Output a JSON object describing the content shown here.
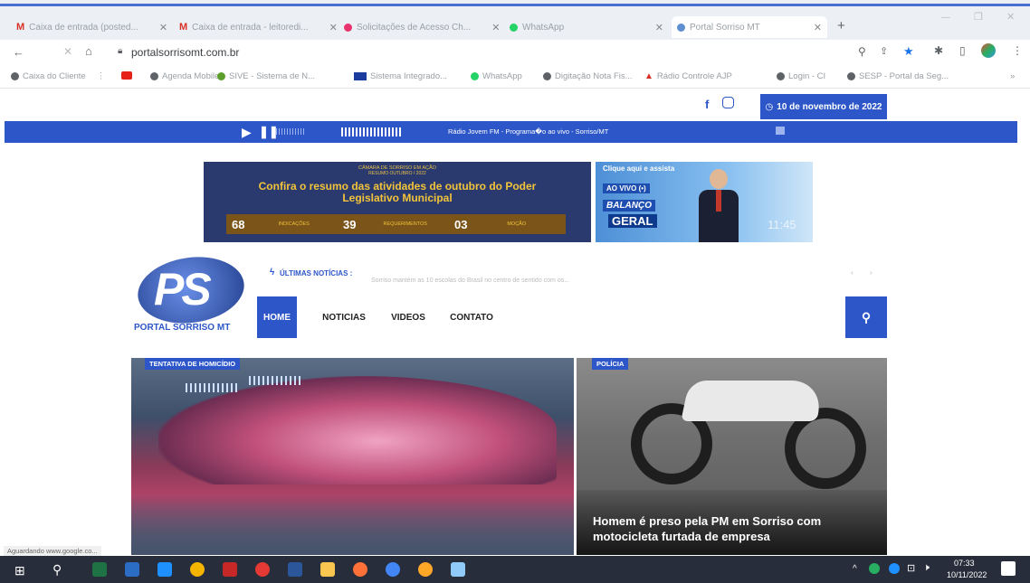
{
  "browser": {
    "tabs": [
      {
        "label": "Caixa de entrada (posted...",
        "icon": "gmail-icon",
        "color": "#d93025"
      },
      {
        "label": "Caixa de entrada - leitoredi...",
        "icon": "gmail-icon",
        "color": "#d93025"
      },
      {
        "label": "Solicitações de Acesso Ch...",
        "icon": "user-icon",
        "color": "#e8336e"
      },
      {
        "label": "WhatsApp",
        "icon": "whatsapp-icon",
        "color": "#25d366"
      },
      {
        "label": "Portal Sorriso MT",
        "icon": "globe-icon",
        "color": "#5f8fd0"
      }
    ],
    "address": "portalsorrisomt.com.br",
    "bookmarks": [
      {
        "label": "Caixa do Cliente",
        "color": "#5f6368"
      },
      {
        "label": "",
        "color": "#e62117"
      },
      {
        "label": "Agenda Mobile",
        "color": "#5f6368"
      },
      {
        "label": "SIVE - Sistema de N...",
        "color": "#5b9f2a"
      },
      {
        "label": "Sistema Integrado...",
        "color": "#1a3c9e"
      },
      {
        "label": "WhatsApp",
        "color": "#25d366"
      },
      {
        "label": "Digitação Nota Fis...",
        "color": "#5f6368"
      },
      {
        "label": "Rádio Controle AJP",
        "color": "#d93025"
      },
      {
        "label": "Login - CI",
        "color": "#5f6368"
      },
      {
        "label": "SESP - Portal da Seg...",
        "color": "#5f6368"
      }
    ]
  },
  "site": {
    "date": "10 de novembro de 2022",
    "radio_text": "Rádio Jovem FM - Programa�o ao vivo - Sorriso/MT",
    "ad1": {
      "kicker": "CÂMARA DE SORRISO EM AÇÃO",
      "sub": "RESUMO OUTUBRO / 2022",
      "headline": "Confira o resumo das atividades de outubro do Poder Legislativo Municipal",
      "stats": [
        {
          "value": "68",
          "label": "INDICAÇÕES"
        },
        {
          "value": "39",
          "label": "REQUERIMENTOS"
        },
        {
          "value": "03",
          "label": "MOÇÃO"
        }
      ]
    },
    "ad2": {
      "line1": "Clique aqui e assista",
      "live": "AO VIVO (•)",
      "show1": "BALANÇO",
      "show2": "GERAL",
      "time": "11:45"
    },
    "logo_text": "PORTAL SORRISO MT",
    "logo_mark": "PS",
    "news_label": "ÚLTIMAS NOTÍCIAS :",
    "news_ticker": "Sorriso mantém as 10 escolas do Brasil no centro de sentido com os...",
    "nav": [
      "HOME",
      "NOTICIAS",
      "VIDEOS",
      "CONTATO"
    ],
    "cards": [
      {
        "category": "TENTATIVA DE HOMICÍDIO",
        "title": ""
      },
      {
        "category": "POLÍCIA",
        "title": "Homem é preso pela PM em Sorriso com motocicleta furtada de empresa"
      }
    ],
    "status_url": "Aguardando www.google.co..."
  },
  "taskbar": {
    "time": "07:33",
    "date": "10/11/2022",
    "apps": [
      {
        "name": "excel",
        "color": "#1f7244"
      },
      {
        "name": "app-blue",
        "color": "#2b6cc4"
      },
      {
        "name": "ie",
        "color": "#1e90ff"
      },
      {
        "name": "chrome",
        "color": "#f4b400"
      },
      {
        "name": "red-app",
        "color": "#c62828"
      },
      {
        "name": "opera",
        "color": "#e53935"
      },
      {
        "name": "word",
        "color": "#2b579a"
      },
      {
        "name": "explorer",
        "color": "#f9c74f"
      },
      {
        "name": "firefox",
        "color": "#ff7139"
      },
      {
        "name": "chrome-alt",
        "color": "#4285f4"
      },
      {
        "name": "orange-app",
        "color": "#ffa726"
      },
      {
        "name": "blue-app",
        "color": "#90caf9"
      }
    ]
  }
}
